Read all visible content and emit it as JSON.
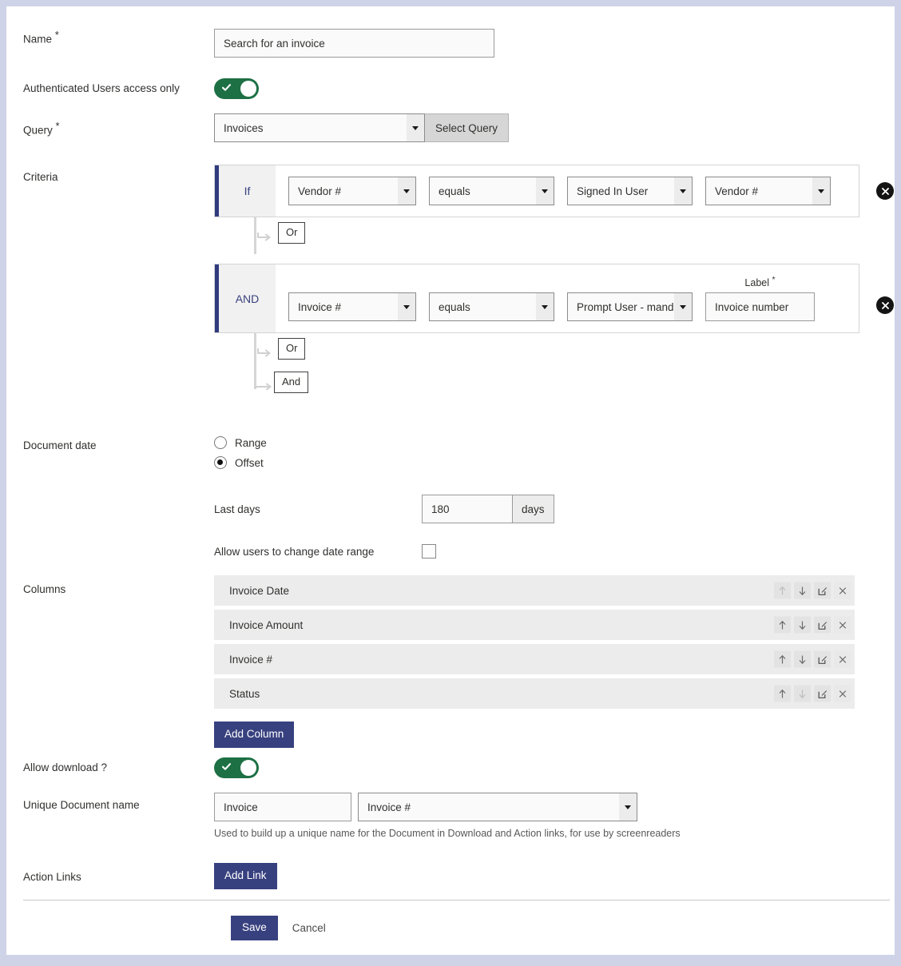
{
  "form": {
    "name": {
      "label": "Name",
      "required": "*",
      "value": "Search for an invoice"
    },
    "authenticated": {
      "label": "Authenticated Users access only",
      "toggle_on": true,
      "icon": "check-icon"
    },
    "query": {
      "label": "Query",
      "required": "*",
      "value": "Invoices",
      "select_button": "Select Query"
    },
    "criteria": {
      "label": "Criteria",
      "rows": [
        {
          "prefix": "If",
          "field": "Vendor #",
          "operator": "equals",
          "source": "Signed In User",
          "value": "Vendor #",
          "value_type": "select",
          "sublabel": "",
          "sublabel_required": "",
          "delete_icon": "close-circle-icon"
        },
        {
          "prefix": "AND",
          "field": "Invoice #",
          "operator": "equals",
          "source": "Prompt User - mandatory",
          "value": "Invoice number",
          "value_type": "text",
          "sublabel": "Label",
          "sublabel_required": "*",
          "delete_icon": "close-circle-icon"
        }
      ],
      "connectors": [
        {
          "op": "Or"
        },
        {
          "op": "Or"
        },
        {
          "op": "And"
        }
      ]
    },
    "document_date": {
      "label": "Document date",
      "options": [
        {
          "label": "Range",
          "selected": false
        },
        {
          "label": "Offset",
          "selected": true
        }
      ],
      "last_days_label": "Last days",
      "last_days_value": "180",
      "last_days_unit": "days",
      "allow_change_label": "Allow users to change date range",
      "allow_change_checked": false
    },
    "columns": {
      "label": "Columns",
      "items": [
        {
          "name": "Invoice Date",
          "up_enabled": false,
          "down_enabled": true
        },
        {
          "name": "Invoice Amount",
          "up_enabled": true,
          "down_enabled": true
        },
        {
          "name": "Invoice #",
          "up_enabled": true,
          "down_enabled": true
        },
        {
          "name": "Status",
          "up_enabled": true,
          "down_enabled": false
        }
      ],
      "row_icons": {
        "up": "arrow-up-icon",
        "down": "arrow-down-icon",
        "edit": "edit-pencil-icon",
        "remove": "close-x-icon"
      },
      "add_button": "Add Column"
    },
    "allow_download": {
      "label": "Allow download ?",
      "toggle_on": true,
      "icon": "check-icon"
    },
    "unique_document_name": {
      "label": "Unique Document name",
      "prefix_value": "Invoice",
      "field_value": "Invoice #",
      "hint": "Used to build up a unique name for the Document in Download and Action links, for use by screenreaders"
    },
    "action_links": {
      "label": "Action Links",
      "add_button": "Add Link"
    },
    "footer": {
      "save": "Save",
      "cancel": "Cancel"
    }
  },
  "colors": {
    "primary": "#38417f",
    "toggle_on": "#1d7044",
    "accent_bar": "#2f3b7e",
    "page_border": "#ced3e8"
  }
}
